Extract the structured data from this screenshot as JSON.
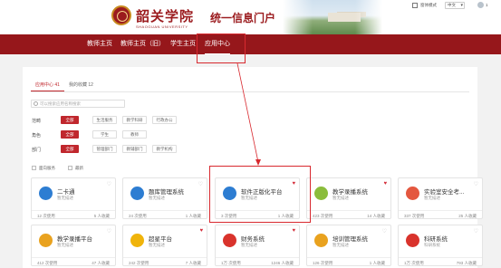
{
  "header": {
    "school_name": "韶关学院",
    "school_en": "SHAOGUAN UNIVERSITY",
    "portal_title": "统一信息门户",
    "topbar": {
      "mode": "窗体模式",
      "language": "中文",
      "user": "1"
    }
  },
  "nav": {
    "items": [
      "教师主页",
      "教师主页（旧）",
      "学生主页",
      "应用中心"
    ]
  },
  "tabs": [
    "应用中心 41",
    "我的收藏 12"
  ],
  "search": {
    "placeholder": "可以搜索应用名称搜索"
  },
  "filters": [
    {
      "label": "范畴",
      "options": [
        "全部",
        "生活服务",
        "教学科研",
        "行政办公"
      ]
    },
    {
      "label": "角色",
      "options": [
        "全部",
        "学生",
        "教师"
      ]
    },
    {
      "label": "部门",
      "options": [
        "全部",
        "管理部门",
        "教辅部门",
        "教学机构"
      ]
    }
  ],
  "checks": [
    "面向服务",
    "最新"
  ],
  "cards": [
    {
      "name": "二卡通",
      "desc": "暂无描述",
      "uses": "12 次使用",
      "favs": "5 人收藏",
      "icon": "card-icon",
      "color": "#2d7dd2",
      "fav": false
    },
    {
      "name": "题库管理系统",
      "desc": "暂无描述",
      "uses": "24 次使用",
      "favs": "1 人收藏",
      "icon": "bank-icon",
      "color": "#2d7dd2",
      "fav": false
    },
    {
      "name": "软件正版化平台",
      "desc": "暂无描述",
      "uses": "3 次使用",
      "favs": "1 人收藏",
      "icon": "software-icon",
      "color": "#2d7dd2",
      "fav": true
    },
    {
      "name": "教学录播系统",
      "desc": "暂无描述",
      "uses": "423 次使用",
      "favs": "14 人收藏",
      "icon": "video-icon",
      "color": "#8bbd3c",
      "fav": true
    },
    {
      "name": "实验室安全考...",
      "desc": "暂无描述",
      "uses": "337 次使用",
      "favs": "25 人收藏",
      "icon": "lab-icon",
      "color": "#e4573f",
      "fav": false
    },
    {
      "name": "教学录播平台",
      "desc": "暂无描述",
      "uses": "412 次使用",
      "favs": "47 人收藏",
      "icon": "platform-icon",
      "color": "#e9a21f",
      "fav": false
    },
    {
      "name": "超星平台",
      "desc": "暂无描述",
      "uses": "242 次使用",
      "favs": "7 人收藏",
      "icon": "chaoxing-icon",
      "color": "#f0b40b",
      "fav": true
    },
    {
      "name": "财务系统",
      "desc": "暂无描述",
      "uses": "1万 次使用",
      "favs": "1246 人收藏",
      "icon": "finance-icon",
      "color": "#d9332c",
      "fav": true
    },
    {
      "name": "培训管理系统",
      "desc": "暂无描述",
      "uses": "126 次使用",
      "favs": "1 人收藏",
      "icon": "training-icon",
      "color": "#e9a21f",
      "fav": false
    },
    {
      "name": "科研系统",
      "desc": "科研系统",
      "uses": "1万 次使用",
      "favs": "793 人收藏",
      "icon": "research-icon",
      "color": "#d9332c",
      "fav": false
    }
  ]
}
